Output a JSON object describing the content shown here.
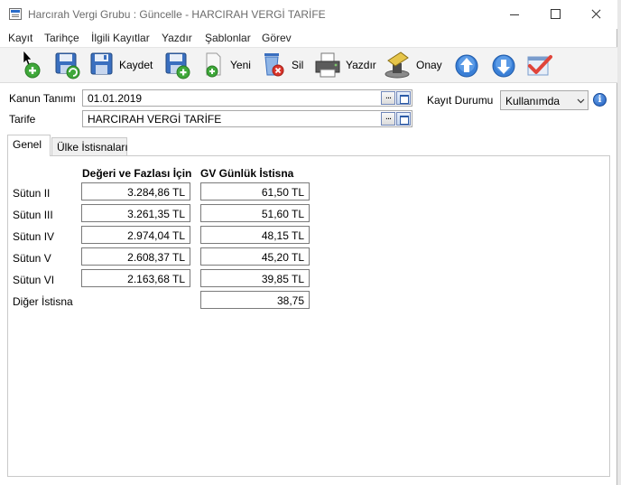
{
  "window": {
    "title": "Harcırah Vergi Grubu : Güncelle - HARCIRAH VERGİ TARİFE"
  },
  "menu": [
    "Kayıt",
    "Tarihçe",
    "İlgili Kayıtlar",
    "Yazdır",
    "Şablonlar",
    "Görev"
  ],
  "toolbar": {
    "save_label": "Kaydet",
    "new_label": "Yeni",
    "delete_label": "Sil",
    "print_label": "Yazdır",
    "approve_label": "Onay"
  },
  "form": {
    "kanun_label": "Kanun Tanımı",
    "kanun_value": "01.01.2019",
    "tarife_label": "Tarife",
    "tarife_value": "HARCIRAH VERGİ TARİFE",
    "kayit_durumu_label": "Kayıt Durumu",
    "kayit_durumu_value": "Kullanımda",
    "dots": "..."
  },
  "tabs": [
    "Genel",
    "Ülke İstisnaları"
  ],
  "grid": {
    "col1_header": "Değeri ve Fazlası İçin",
    "col2_header": "GV Günlük İstisna",
    "rows": [
      {
        "label": "Sütun II",
        "value": "3.284,86 TL",
        "exemption": "61,50 TL"
      },
      {
        "label": "Sütun III",
        "value": "3.261,35 TL",
        "exemption": "51,60 TL"
      },
      {
        "label": "Sütun IV",
        "value": "2.974,04 TL",
        "exemption": "48,15 TL"
      },
      {
        "label": "Sütun V",
        "value": "2.608,37 TL",
        "exemption": "45,20 TL"
      },
      {
        "label": "Sütun VI",
        "value": "2.163,68 TL",
        "exemption": "39,85 TL"
      }
    ],
    "other_label": "Diğer İstisna",
    "other_value": "38,75"
  },
  "colors": {
    "toolbar_bg": "#f3f3f3",
    "accent_blue": "#2a6cc9",
    "delete_red": "#d9342b",
    "approve_red": "#e0443a"
  }
}
